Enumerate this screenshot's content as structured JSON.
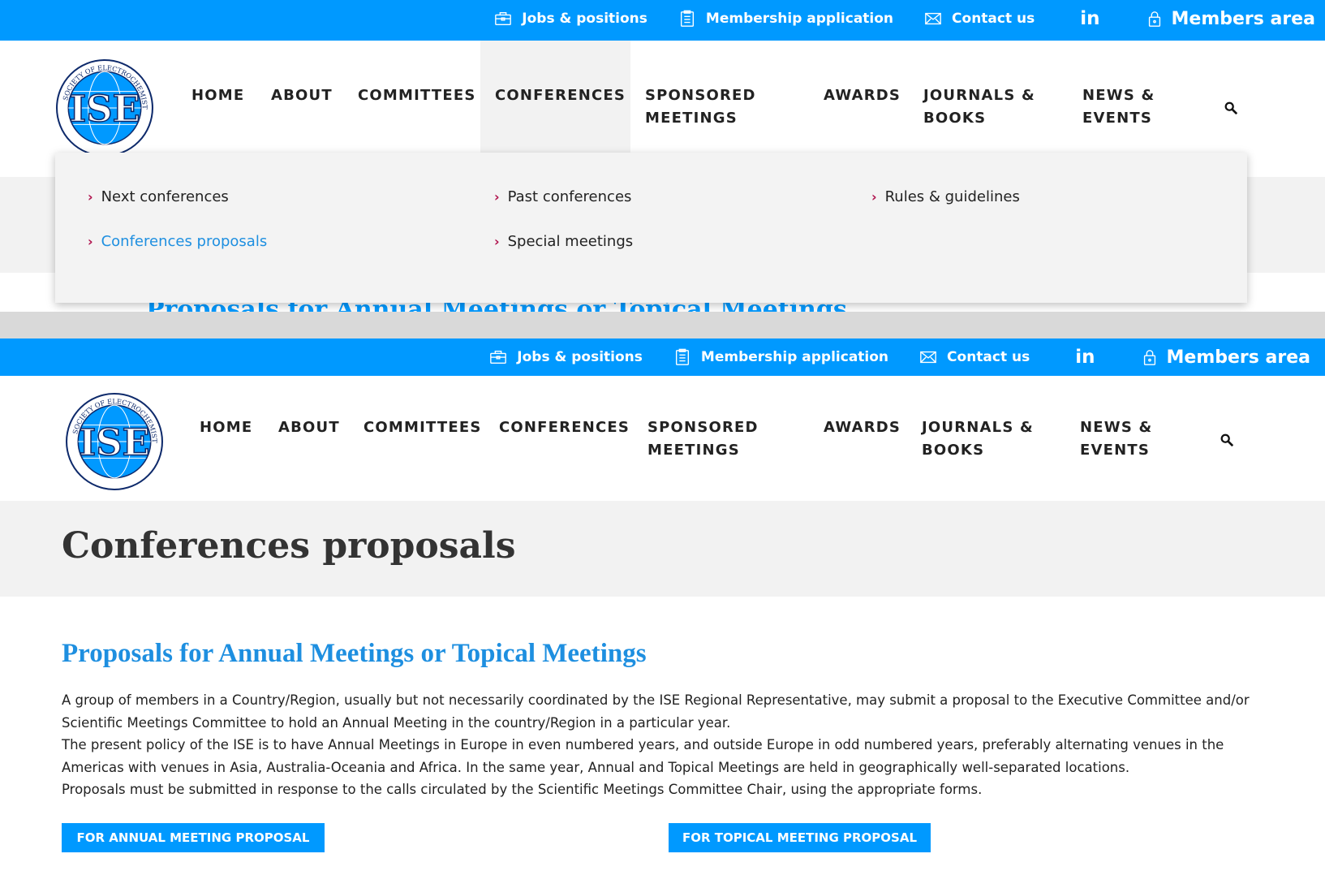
{
  "topbar": {
    "jobs": {
      "label": "Jobs & positions",
      "icon": "briefcase-icon"
    },
    "membership": {
      "label": "Membership application",
      "icon": "clipboard-icon"
    },
    "contact": {
      "label": "Contact us",
      "icon": "envelope-icon"
    },
    "linkedin": {
      "label": "in",
      "icon": "linkedin-icon"
    },
    "members": {
      "label": "Members area",
      "icon": "lock-icon"
    }
  },
  "logo": {
    "text": "ISE",
    "ring_text": "INTERNATIONAL SOCIETY OF ELECTROCHEMISTRY"
  },
  "nav": {
    "home": "HOME",
    "about": "ABOUT",
    "committees": "COMMITTEES",
    "conferences": "CONFERENCES",
    "sponsored_1": "SPONSORED",
    "sponsored_2": "MEETINGS",
    "awards": "AWARDS",
    "journals_1": "JOURNALS &",
    "journals_2": "BOOKS",
    "news_1": "NEWS &",
    "news_2": "EVENTS"
  },
  "dropdown": {
    "next": "Next conferences",
    "past": "Past conferences",
    "rules": "Rules & guidelines",
    "proposals": "Conferences proposals",
    "special": "Special meetings"
  },
  "page": {
    "title": "Conferences proposals",
    "section_title": "Proposals for Annual Meetings or Topical Meetings",
    "para1": "A group of members in a Country/Region, usually but not necessarily coordinated by the ISE Regional Representative, may submit a proposal to the Executive Committee and/or Scientific Meetings Committee to hold an Annual Meeting in the country/Region in a particular year.",
    "para2": "The present policy of the ISE is to have Annual Meetings in Europe in even numbered years, and outside Europe in odd numbered years, preferably alternating venues in the Americas with venues in Asia, Australia-Oceania and Africa. In the same year, Annual and Topical Meetings are held in geographically well-separated locations.",
    "para3": "Proposals must be submitted in response to the calls circulated by the Scientific Meetings Committee Chair, using the appropriate forms.",
    "btn_annual": "FOR ANNUAL MEETING PROPOSAL",
    "btn_topical": "FOR TOPICAL MEETING PROPOSAL"
  },
  "colors": {
    "brand_blue": "#0099ff",
    "link_blue": "#1e8fe0",
    "chevron": "#b0124d",
    "band_gray": "#f2f2f2"
  }
}
